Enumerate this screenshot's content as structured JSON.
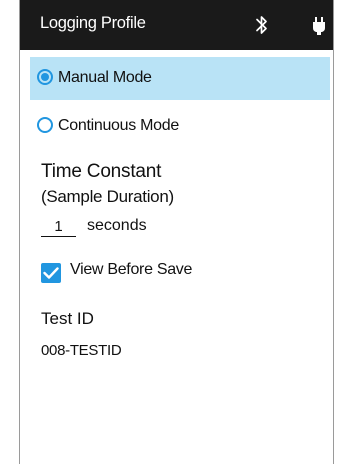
{
  "header": {
    "title": "Logging Profile",
    "icons": [
      "bluetooth-icon",
      "plug-icon"
    ]
  },
  "modes": [
    {
      "label": "Manual Mode",
      "selected": true
    },
    {
      "label": "Continuous Mode",
      "selected": false
    }
  ],
  "time_constant": {
    "title": "Time Constant",
    "subtitle": "(Sample Duration)",
    "value": "1",
    "unit": "seconds"
  },
  "view_before_save": {
    "label": "View Before Save",
    "checked": true
  },
  "test_id": {
    "label": "Test ID",
    "value": "008-TESTID"
  },
  "colors": {
    "header_bg": "#1a1a1a",
    "selected_bg": "#b9e3f6",
    "accent": "#2196e0"
  }
}
